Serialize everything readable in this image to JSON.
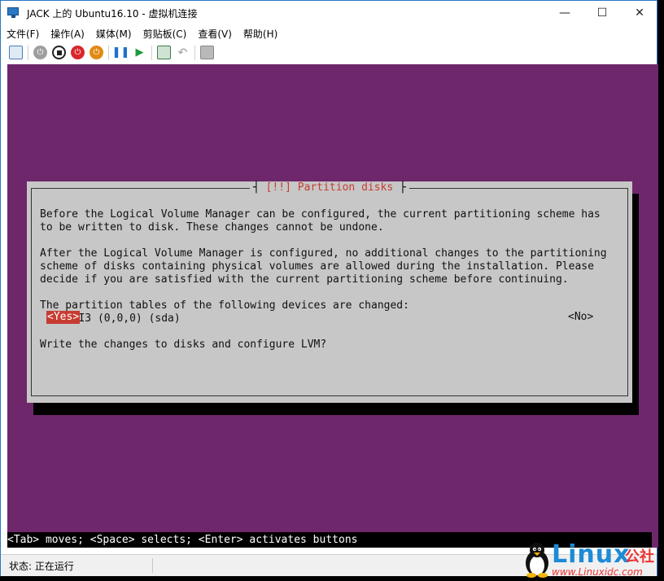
{
  "window": {
    "title": "JACK 上的 Ubuntu16.10 - 虚拟机连接",
    "minimize": "—",
    "maximize": "☐",
    "close": "✕"
  },
  "menu": [
    "文件(F)",
    "操作(A)",
    "媒体(M)",
    "剪贴板(C)",
    "查看(V)",
    "帮助(H)"
  ],
  "toolbar_icons": [
    "ctrl-alt-del-icon",
    "start-icon",
    "turn-off-icon",
    "shutdown-icon",
    "save-icon",
    "pause-icon",
    "reset-icon",
    "checkpoint-icon",
    "revert-icon",
    "enhanced-session-icon"
  ],
  "dialog": {
    "title_left": "[!!]",
    "title": "Partition disks",
    "para1_line1": "Before the Logical Volume Manager can be configured, the current partitioning scheme has",
    "para1_line2": "to be written to disk. These changes cannot be undone.",
    "para2_line1": "After the Logical Volume Manager is configured, no additional changes to the partitioning",
    "para2_line2": "scheme of disks containing physical volumes are allowed during the installation. Please",
    "para2_line3": "decide if you are satisfied with the current partitioning scheme before continuing.",
    "para3_line1": "The partition tables of the following devices are changed:",
    "device": "SCSI3 (0,0,0) (sda)",
    "question": "Write the changes to disks and configure LVM?",
    "yes": "<Yes>",
    "no": "<No>"
  },
  "hint": "<Tab> moves; <Space> selects; <Enter> activates buttons",
  "status": "状态: 正在运行",
  "logo": {
    "text": "Linux",
    "cn": "公社",
    "url": "www.Linuxidc.com"
  },
  "colors": {
    "vm_background": "#6e276b",
    "dialog_background": "#c7c7c7",
    "highlight": "#c73b31"
  }
}
